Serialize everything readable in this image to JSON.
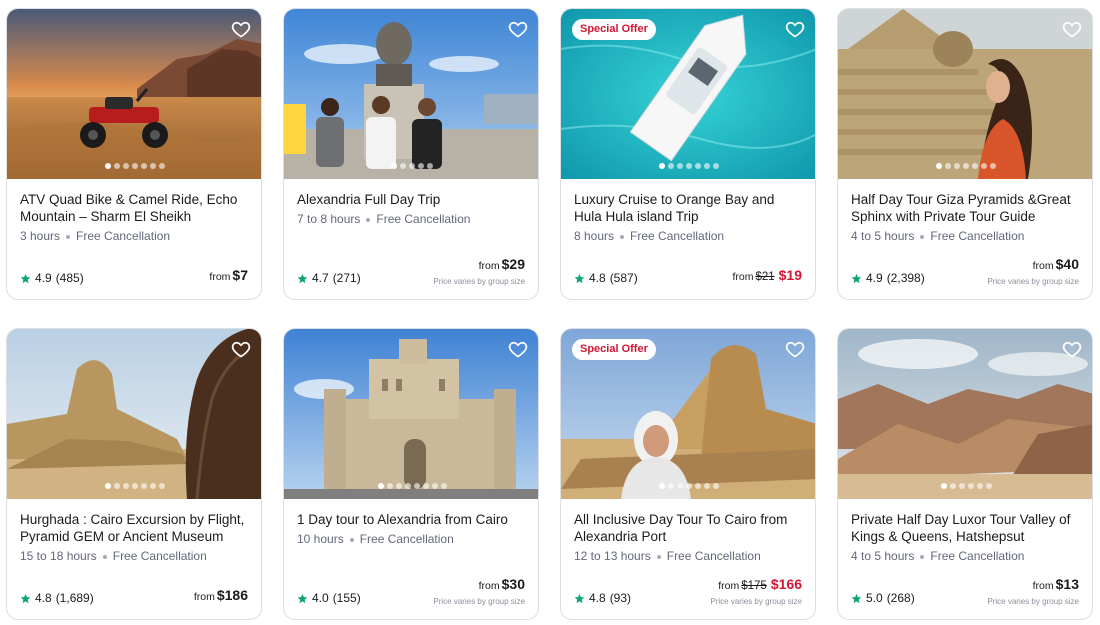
{
  "tours": [
    {
      "title": "ATV Quad Bike & Camel Ride, Echo Mountain – Sharm El Sheikh",
      "duration": "3 hours",
      "cancellation": "Free Cancellation",
      "rating": "4.9",
      "reviews": "(485)",
      "from_label": "from",
      "price": "$7",
      "badge": "",
      "varies": "",
      "image_icon": "atv-quad-bike-desert-photo"
    },
    {
      "title": "Alexandria Full Day Trip",
      "duration": "7 to 8 hours",
      "cancellation": "Free Cancellation",
      "rating": "4.7",
      "reviews": "(271)",
      "from_label": "from",
      "price": "$29",
      "badge": "",
      "varies": "Price varies by group size",
      "image_icon": "alexandria-statue-tourists-photo"
    },
    {
      "title": "Luxury Cruise to Orange Bay and Hula Hula island Trip",
      "duration": "8 hours",
      "cancellation": "Free Cancellation",
      "rating": "4.8",
      "reviews": "(587)",
      "from_label": "from",
      "old_price": "$21",
      "price": "$19",
      "badge": "Special Offer",
      "varies": "",
      "image_icon": "yacht-turquoise-sea-photo"
    },
    {
      "title": "Half Day Tour Giza Pyramids &Great Sphinx with Private Tour Guide",
      "duration": "4 to 5 hours",
      "cancellation": "Free Cancellation",
      "rating": "4.9",
      "reviews": "(2,398)",
      "from_label": "from",
      "price": "$40",
      "badge": "",
      "varies": "Price varies by group size",
      "image_icon": "sphinx-pyramid-woman-photo"
    },
    {
      "title": "Hurghada : Cairo Excursion by Flight, Pyramid GEM or Ancient Museum",
      "duration": "15 to 18 hours",
      "cancellation": "Free Cancellation",
      "rating": "4.8",
      "reviews": "(1,689)",
      "from_label": "from",
      "price": "$186",
      "badge": "",
      "varies": "",
      "image_icon": "sphinx-profile-hair-photo"
    },
    {
      "title": "1 Day tour to Alexandria from Cairo",
      "duration": "10 hours",
      "cancellation": "Free Cancellation",
      "rating": "4.0",
      "reviews": "(155)",
      "from_label": "from",
      "price": "$30",
      "badge": "",
      "varies": "Price varies by group size",
      "image_icon": "qaitbay-citadel-photo"
    },
    {
      "title": "All Inclusive Day Tour To Cairo from Alexandria Port",
      "duration": "12 to 13 hours",
      "cancellation": "Free Cancellation",
      "rating": "4.8",
      "reviews": "(93)",
      "from_label": "from",
      "old_price": "$175",
      "price": "$166",
      "badge": "Special Offer",
      "varies": "Price varies by group size",
      "image_icon": "sphinx-headscarf-woman-photo"
    },
    {
      "title": "Private Half Day Luxor Tour Valley of Kings & Queens, Hatshepsut",
      "duration": "4 to 5 hours",
      "cancellation": "Free Cancellation",
      "rating": "5.0",
      "reviews": "(268)",
      "from_label": "from",
      "price": "$13",
      "badge": "",
      "varies": "Price varies by group size",
      "image_icon": "valley-of-kings-desert-photo"
    }
  ],
  "colors": {
    "star": "#0fa573",
    "sale": "#d31635",
    "text": "#1a1b1d",
    "muted": "#63687a"
  }
}
